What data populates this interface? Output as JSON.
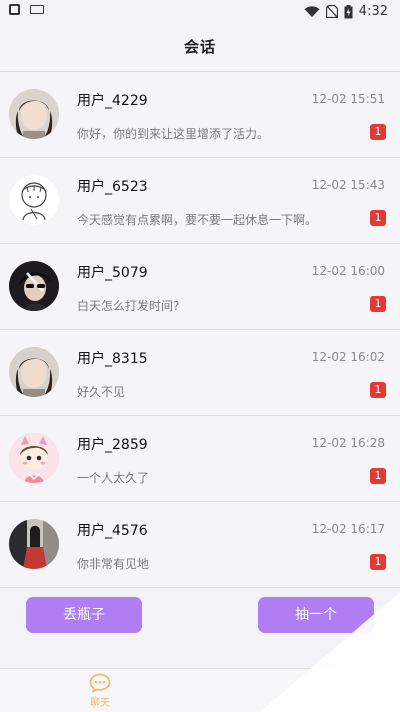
{
  "status_bar": {
    "time": "4:32"
  },
  "header": {
    "title": "会话"
  },
  "conversations": [
    {
      "name": "用户_4229",
      "time": "12-02 15:51",
      "message": "你好，你的到来让这里增添了活力。",
      "unread": "1"
    },
    {
      "name": "用户_6523",
      "time": "12-02 15:43",
      "message": "今天感觉有点累啊，要不要一起休息一下啊。",
      "unread": "1"
    },
    {
      "name": "用户_5079",
      "time": "12-02 16:00",
      "message": "白天怎么打发时间?",
      "unread": "1"
    },
    {
      "name": "用户_8315",
      "time": "12-02 16:02",
      "message": "好久不见",
      "unread": "1"
    },
    {
      "name": "用户_2859",
      "time": "12-02 16:28",
      "message": "一个人太久了",
      "unread": "1"
    },
    {
      "name": "用户_4576",
      "time": "12-02 16:17",
      "message": "你非常有见地",
      "unread": "1"
    }
  ],
  "actions": {
    "throw_bottle": "丢瓶子",
    "draw_one": "抽一个"
  },
  "tabbar": {
    "chat_label": "聊天"
  },
  "colors": {
    "accent": "#b17df3",
    "badge": "#e53935",
    "tab_active": "#f5b96b"
  },
  "icons": [
    "avatar-photo",
    "avatar-sketch",
    "chat-bubble-icon",
    "wifi-icon",
    "battery-icon"
  ]
}
